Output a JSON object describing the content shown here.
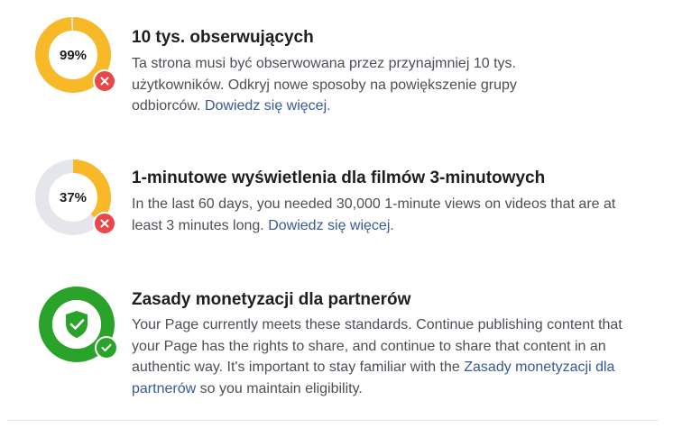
{
  "requirements": [
    {
      "progress_percent": 99,
      "progress_label": "99%",
      "status": "failed",
      "status_icon": "close-icon",
      "title": "10 tys. obserwujących",
      "description": "Ta strona musi być obserwowana przez przynajmniej 10 tys. użytkowników. Odkryj nowe sposoby na powiększenie grupy odbiorców.",
      "link_text": "Dowiedz się więcej."
    },
    {
      "progress_percent": 37,
      "progress_label": "37%",
      "status": "failed",
      "status_icon": "close-icon",
      "title": "1-minutowe wyświetlenia dla filmów 3-minutowych",
      "description": "In the last 60 days, you needed 30,000 1-minute views on videos that are at least 3 minutes long.",
      "link_text": "Dowiedz się więcej."
    },
    {
      "progress_percent": 100,
      "status": "passed",
      "icon": "shield-check-icon",
      "status_icon": "check-icon",
      "title": "Zasady monetyzacji dla partnerów",
      "description_before": "Your Page currently meets these standards. Continue publishing content that your Page has the rights to share, and continue to share that content in an authentic way. It's important to stay familiar with the",
      "link_text": "Zasady monetyzacji dla partnerów",
      "description_after": "so you maintain eligibility."
    }
  ],
  "colors": {
    "progress": "#f7b928",
    "track": "#e4e6eb",
    "success": "#2aa32b",
    "error": "#e8484a",
    "link": "#385898"
  }
}
